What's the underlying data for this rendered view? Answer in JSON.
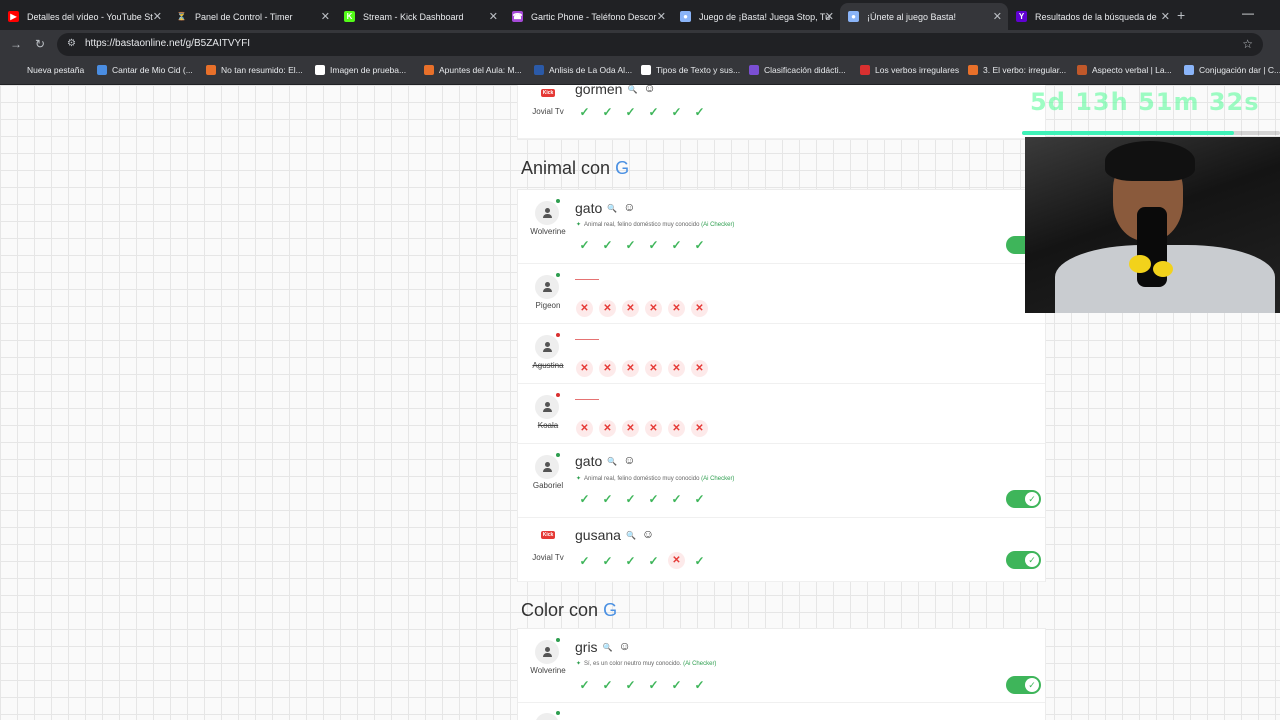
{
  "browser": {
    "tabs": [
      {
        "label": "Detalles del vídeo - YouTube St",
        "color": "#ff0000",
        "glyph": "▶"
      },
      {
        "label": "Panel de Control - Timer",
        "color": "#202124",
        "glyph": "⏳"
      },
      {
        "label": "Stream - Kick Dashboard",
        "color": "#53fc18",
        "glyph": "K"
      },
      {
        "label": "Gartic Phone - Teléfono Descor",
        "color": "#a64ad9",
        "glyph": "☎"
      },
      {
        "label": "Juego de ¡Basta! Juega Stop, Tu",
        "color": "#8ab4f8",
        "glyph": "●"
      },
      {
        "label": "¡Únete al juego Basta!",
        "color": "#8ab4f8",
        "glyph": "●"
      },
      {
        "label": "Resultados de la búsqueda de",
        "color": "#6001d2",
        "glyph": "Y"
      }
    ],
    "new_tab": "+",
    "window_controls": [
      "—",
      "☐",
      "✕"
    ],
    "url": "https://bastaonline.net/g/B5ZAITVYFI",
    "bookmarks": [
      {
        "label": "Nueva pestaña",
        "color": "#35363a"
      },
      {
        "label": "Cantar de Mio Cid (...",
        "color": "#4a8de2"
      },
      {
        "label": "No tan resumido: El...",
        "color": "#e8702a"
      },
      {
        "label": "Imagen de prueba...",
        "color": "#ffffff"
      },
      {
        "label": "Apuntes del Aula: M...",
        "color": "#e8702a"
      },
      {
        "label": "Anlisis de La Oda Al...",
        "color": "#2b5aa8"
      },
      {
        "label": "Tipos de Texto y sus...",
        "color": "#ffffff"
      },
      {
        "label": "Clasificación didácti...",
        "color": "#7b4fd4"
      },
      {
        "label": "Los verbos irregulares",
        "color": "#d93030"
      },
      {
        "label": "3. El verbo: irregular...",
        "color": "#e8702a"
      },
      {
        "label": "Aspecto verbal | La...",
        "color": "#c0582a"
      },
      {
        "label": "Conjugación dar | C...",
        "color": "#8ab4f8"
      }
    ]
  },
  "overlay": {
    "timer": "5d 13h 51m 32s",
    "progress": 0.82
  },
  "game": {
    "top_row": {
      "player": "Jovial Tv",
      "answer": "gormen",
      "marks": [
        "ok",
        "ok",
        "ok",
        "ok",
        "ok",
        "ok"
      ],
      "avatar": "kick"
    },
    "sections": [
      {
        "title": "Animal con",
        "letter": "G",
        "rows": [
          {
            "player": "Wolverine",
            "answer": "gato",
            "ai_note": "Animal real, felino doméstico muy conocido",
            "ai_checker": "(Ai Checker)",
            "marks": [
              "ok",
              "ok",
              "ok",
              "ok",
              "ok",
              "ok"
            ],
            "online": true,
            "toggle": true
          },
          {
            "player": "Pigeon",
            "answer": "",
            "marks": [
              "no",
              "no",
              "no",
              "no",
              "no",
              "no"
            ],
            "online": true,
            "toggle": false
          },
          {
            "player": "Agustina",
            "answer": "",
            "marks": [
              "no",
              "no",
              "no",
              "no",
              "no",
              "no"
            ],
            "online": false,
            "toggle": false,
            "strike": true
          },
          {
            "player": "Koala",
            "answer": "",
            "marks": [
              "no",
              "no",
              "no",
              "no",
              "no",
              "no"
            ],
            "online": false,
            "toggle": false,
            "strike": true
          },
          {
            "player": "Gaboriel",
            "answer": "gato",
            "ai_note": "Animal real, felino doméstico muy conocido",
            "ai_checker": "(Ai Checker)",
            "marks": [
              "ok",
              "ok",
              "ok",
              "ok",
              "ok",
              "ok"
            ],
            "online": true,
            "toggle": true
          },
          {
            "player": "Jovial Tv",
            "answer": "gusana",
            "marks": [
              "ok",
              "ok",
              "ok",
              "ok",
              "no",
              "ok"
            ],
            "avatar": "kick",
            "toggle": true
          }
        ]
      },
      {
        "title": "Color con",
        "letter": "G",
        "rows": [
          {
            "player": "Wolverine",
            "answer": "gris",
            "ai_note": "Sí, es un color neutro muy conocido.",
            "ai_checker": "(Ai Checker)",
            "marks": [
              "ok",
              "ok",
              "ok",
              "ok",
              "ok",
              "ok"
            ],
            "online": true,
            "toggle": true
          }
        ]
      }
    ]
  },
  "icons": {
    "ok": "✓",
    "no": "✕",
    "search": "🔍",
    "smile": "☺",
    "spark": "✦",
    "kick_badge": "Kick"
  }
}
